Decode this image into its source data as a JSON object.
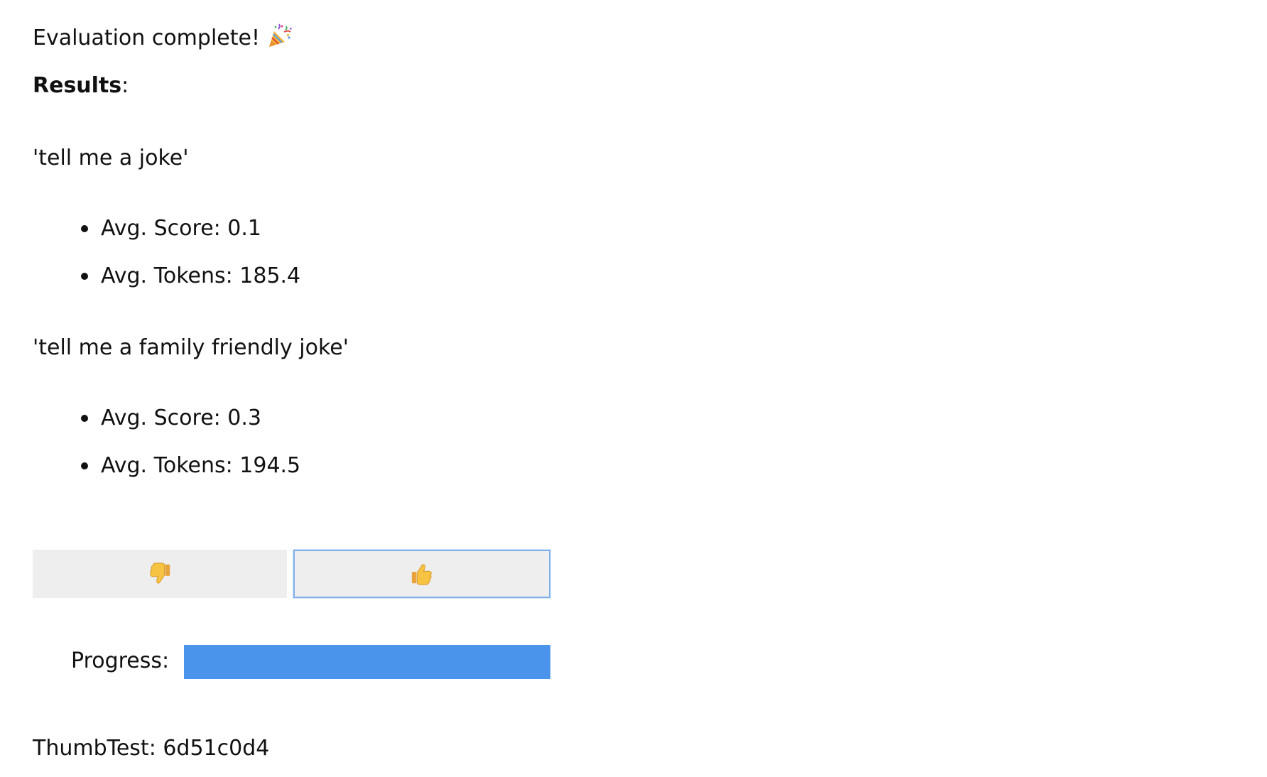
{
  "header": {
    "title": "Evaluation complete!",
    "title_icon": "party-popper-icon",
    "results_label": "Results",
    "results_suffix": ":"
  },
  "results": [
    {
      "prompt": "'tell me a joke'",
      "stats": [
        "Avg. Score: 0.1",
        "Avg. Tokens: 185.4"
      ]
    },
    {
      "prompt": "'tell me a family friendly joke'",
      "stats": [
        "Avg. Score: 0.3",
        "Avg. Tokens: 194.5"
      ]
    }
  ],
  "vote": {
    "down_icon": "thumbs-down-icon",
    "up_icon": "thumbs-up-icon"
  },
  "progress": {
    "label": "Progress:",
    "value": 1.0
  },
  "footer": {
    "text": "ThumbTest: 6d51c0d4"
  },
  "colors": {
    "progress_fill": "#4a94eb",
    "button_bg": "#eeeeee",
    "focus_border": "#7fb0ea",
    "thumb_yellow": "#f6c343"
  }
}
